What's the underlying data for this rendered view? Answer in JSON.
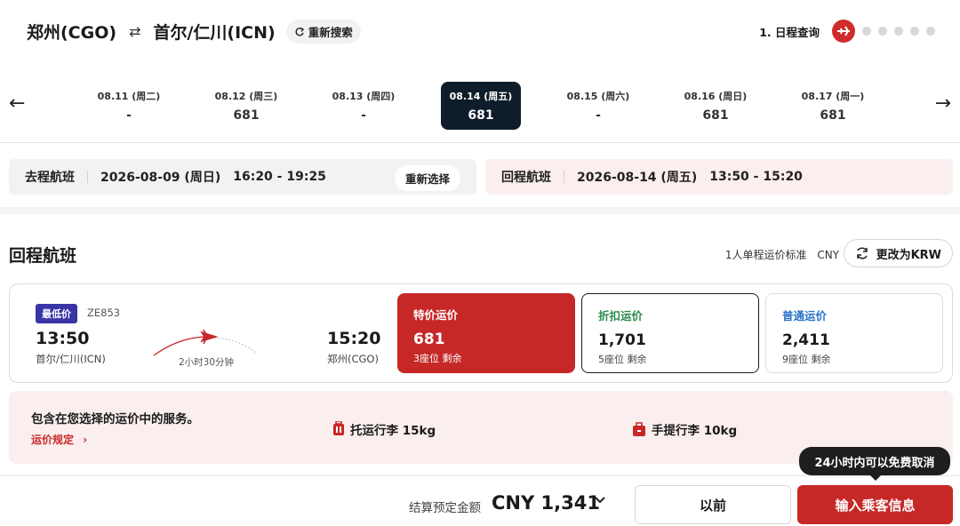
{
  "header": {
    "origin": "郑州(CGO)",
    "swap_icon": "⇄",
    "destination": "首尔/仁川(ICN)",
    "research_label": "重新搜索",
    "step_label": "1. 日程查询"
  },
  "dates": [
    {
      "date": "08.11 (周二)",
      "price": "-"
    },
    {
      "date": "08.12 (周三)",
      "price": "681"
    },
    {
      "date": "08.13 (周四)",
      "price": "-"
    },
    {
      "date": "08.14 (周五)",
      "price": "681",
      "selected": true
    },
    {
      "date": "08.15 (周六)",
      "price": "-"
    },
    {
      "date": "08.16 (周日)",
      "price": "681"
    },
    {
      "date": "08.17 (周一)",
      "price": "681"
    }
  ],
  "outbound": {
    "label": "去程航班",
    "date": "2026-08-09 (周日)",
    "time": "16:20 - 19:25",
    "reselect": "重新选择"
  },
  "return": {
    "label": "回程航班",
    "date": "2026-08-14 (周五)",
    "time": "13:50 - 15:20"
  },
  "section": {
    "title": "回程航班",
    "fare_basis": "1人单程运价标准",
    "currency": "CNY",
    "change_currency": "更改为KRW"
  },
  "flight": {
    "badge": "最低价",
    "number": "ZE853",
    "dep_time": "13:50",
    "dep_city": "首尔/仁川(ICN)",
    "duration": "2小时30分钟",
    "arr_time": "15:20",
    "arr_city": "郑州(CGO)"
  },
  "fares": [
    {
      "name": "特价运价",
      "price": "681",
      "seats": "3座位 剩余"
    },
    {
      "name": "折扣运价",
      "price": "1,701",
      "seats": "5座位 剩余"
    },
    {
      "name": "普通运价",
      "price": "2,411",
      "seats": "9座位 剩余"
    }
  ],
  "services": {
    "title": "包含在您选择的运价中的服务。",
    "rules": "运价规定",
    "rules_chevron": "›",
    "checked": "托运行李 15kg",
    "carry": "手提行李 10kg"
  },
  "bottom": {
    "total_label": "结算预定金额",
    "total_value": "CNY 1,341",
    "prev": "以前",
    "next": "输入乘客信息",
    "tooltip": "24小时内可以免费取消"
  },
  "colors": {
    "accent": "#c62828",
    "dark": "#0f1d2b",
    "badge": "#3a35a7"
  }
}
